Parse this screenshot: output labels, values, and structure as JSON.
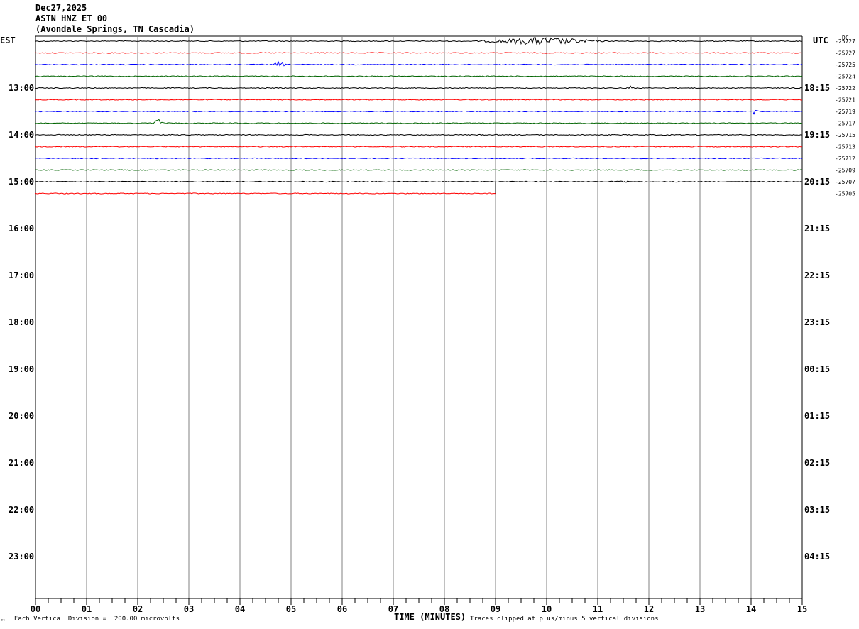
{
  "header": {
    "date": "Dec27,2025",
    "channel": "ASTN HNZ ET 00",
    "location": "(Avondale Springs, TN Cascadia)"
  },
  "left_tz": "EST",
  "right_tz": "UTC",
  "dc_label": "DC",
  "footer": {
    "scale_note": "Each Vertical Division =  200.00 microvolts",
    "clip_note": "Traces clipped at plus/minus 5 vertical divisions",
    "logo": "✂"
  },
  "colors": {
    "trace_cycle": [
      "#000000",
      "#ff0000",
      "#0000ff",
      "#006400"
    ],
    "grid": "#808080"
  },
  "chart_data": {
    "type": "line",
    "title": "ASTN HNZ ET 00",
    "xlabel": "TIME (MINUTES)",
    "xlim": [
      0,
      15
    ],
    "x_ticks": [
      "00",
      "01",
      "02",
      "03",
      "04",
      "05",
      "06",
      "07",
      "08",
      "09",
      "10",
      "11",
      "12",
      "13",
      "14",
      "15"
    ],
    "rows_per_hour": 4,
    "row_minutes": 15,
    "hour_labels_local": [
      "13:00",
      "14:00",
      "15:00",
      "16:00",
      "17:00",
      "18:00",
      "19:00",
      "20:00",
      "21:00",
      "22:00",
      "23:00"
    ],
    "hour_labels_utc": [
      "18:15",
      "19:15",
      "20:15",
      "21:15",
      "22:15",
      "23:15",
      "00:15",
      "01:15",
      "02:15",
      "03:15",
      "04:15"
    ],
    "dc_offsets": [
      "-25727",
      "-25727",
      "-25725",
      "-25724",
      "-25722",
      "-25721",
      "-25719",
      "-25717",
      "-25715",
      "-25713",
      "-25712",
      "-25709",
      "-25707",
      "-25705"
    ],
    "trace_end_minutes": [
      15,
      15,
      15,
      15,
      15,
      15,
      15,
      15,
      15,
      15,
      15,
      15,
      15,
      9
    ],
    "events": [
      {
        "row": 0,
        "start_min": 8.6,
        "end_min": 11.2,
        "amp": 6
      },
      {
        "row": 2,
        "start_min": 4.65,
        "end_min": 4.9,
        "amp": 5
      },
      {
        "row": 4,
        "start_min": 11.55,
        "end_min": 11.75,
        "amp": 4
      },
      {
        "row": 6,
        "start_min": 14.0,
        "end_min": 14.15,
        "amp": 7
      },
      {
        "row": 7,
        "start_min": 2.3,
        "end_min": 2.5,
        "amp": 9
      },
      {
        "row": 12,
        "start_min": 11.2,
        "end_min": 11.7,
        "amp": 2
      }
    ]
  }
}
